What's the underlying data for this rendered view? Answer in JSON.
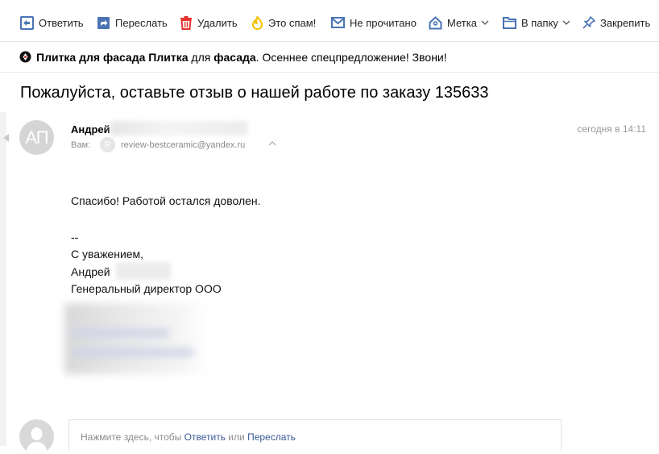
{
  "toolbar": {
    "reply": "Ответить",
    "forward": "Переслать",
    "delete": "Удалить",
    "spam": "Это спам!",
    "unread": "Не прочитано",
    "label": "Метка",
    "folder": "В папку",
    "pin": "Закрепить"
  },
  "promo": {
    "bold1": "Плитка для фасада",
    "bold2": "Плитка",
    "middle": "для",
    "bold3": "фасада",
    "rest": ". Осеннее спецпредложение! Звони!"
  },
  "subject": "Пожалуйста, оставьте отзыв о нашей работе по заказу 135633",
  "message": {
    "avatar_initials": "АП",
    "sender_name": "Андрей",
    "to_label": "Вам:",
    "to_avatar_letter": "R",
    "to_email": "review-bestceramic@yandex.ru",
    "date": "сегодня в 14:11",
    "body": {
      "line1": "Спасибо! Работой остался доволен.",
      "sig_sep": "--",
      "regards": "С уважением,",
      "name": "Андрей",
      "position": "Генеральный директор ООО"
    }
  },
  "reply_box": {
    "prefix": "Нажмите здесь, чтобы",
    "reply_link": "Ответить",
    "or": "или",
    "forward_link": "Переслать"
  },
  "colors": {
    "accent_blue": "#3b5998",
    "delete_red": "#e3342f",
    "spam_yellow": "#f2c200",
    "icon_blue": "#4a74b4"
  }
}
